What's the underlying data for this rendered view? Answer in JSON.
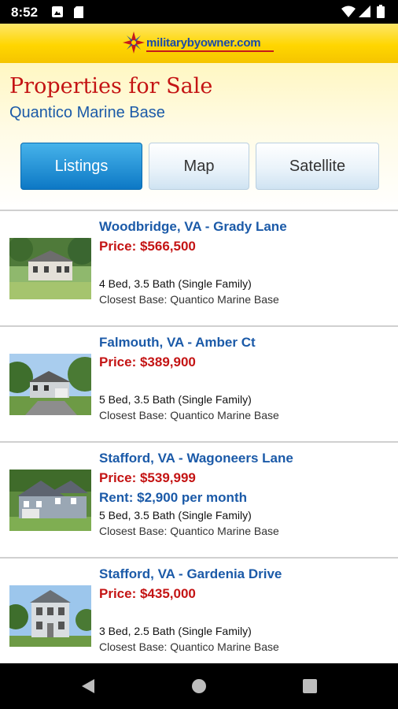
{
  "status_bar": {
    "time": "8:52",
    "icons": [
      "notification-photo-icon",
      "notification-sd-icon",
      "wifi-icon",
      "cellular-signal-icon",
      "battery-icon"
    ]
  },
  "banner": {
    "logo_text": "militarybyowner.com",
    "logo_colors": {
      "text": "#1a4aa8",
      "accent": "#c61a1a",
      "background": "#ffd600"
    }
  },
  "header": {
    "title": "Properties for Sale",
    "subtitle": "Quantico Marine Base"
  },
  "tabs": [
    {
      "label": "Listings",
      "active": true
    },
    {
      "label": "Map",
      "active": false
    },
    {
      "label": "Satellite",
      "active": false
    }
  ],
  "listings": [
    {
      "title": "Woodbridge, VA - Grady Lane",
      "price": "Price: $566,500",
      "rent": "",
      "beds": "4 Bed, 3.5 Bath (Single Family)",
      "base": "Closest Base: Quantico Marine Base"
    },
    {
      "title": "Falmouth, VA - Amber Ct",
      "price": "Price: $389,900",
      "rent": "",
      "beds": "5 Bed, 3.5 Bath (Single Family)",
      "base": "Closest Base: Quantico Marine Base"
    },
    {
      "title": "Stafford, VA - Wagoneers Lane",
      "price": "Price: $539,999",
      "rent": "Rent: $2,900 per month",
      "beds": "5 Bed, 3.5 Bath (Single Family)",
      "base": "Closest Base: Quantico Marine Base"
    },
    {
      "title": "Stafford, VA - Gardenia Drive",
      "price": "Price: $435,000",
      "rent": "",
      "beds": "3 Bed, 2.5 Bath (Single Family)",
      "base": "Closest Base: Quantico Marine Base"
    }
  ],
  "nav_bar": {
    "buttons": [
      "back-icon",
      "home-icon",
      "recents-icon"
    ]
  },
  "colors": {
    "title_red": "#c41414",
    "link_blue": "#1b5aa8",
    "tab_active": "#1a8ad6"
  }
}
